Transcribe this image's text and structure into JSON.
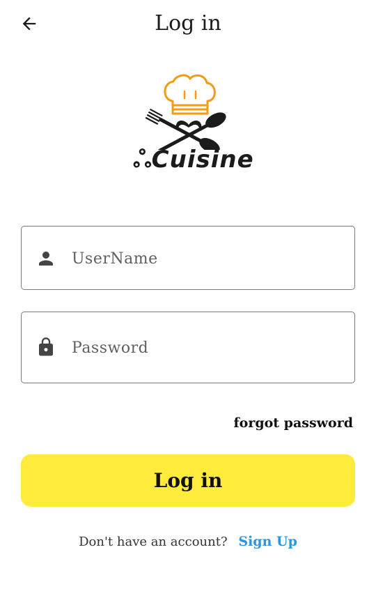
{
  "app_bar": {
    "title": "Log in",
    "back_icon": "arrow-left-icon"
  },
  "logo": {
    "glyph": "ஃ",
    "wordmark": "Cuisine",
    "hat_color": "#f39c12"
  },
  "form": {
    "username": {
      "placeholder": "UserName",
      "value": "",
      "icon": "person-icon"
    },
    "password": {
      "placeholder": "Password",
      "value": "",
      "icon": "lock-icon"
    },
    "forgot_label": "forgot password"
  },
  "actions": {
    "login_label": "Log in",
    "login_color": "#ffeb3b"
  },
  "signup": {
    "prompt": "Don't have an account?",
    "link_label": "Sign Up",
    "link_color": "#2d96dc"
  }
}
